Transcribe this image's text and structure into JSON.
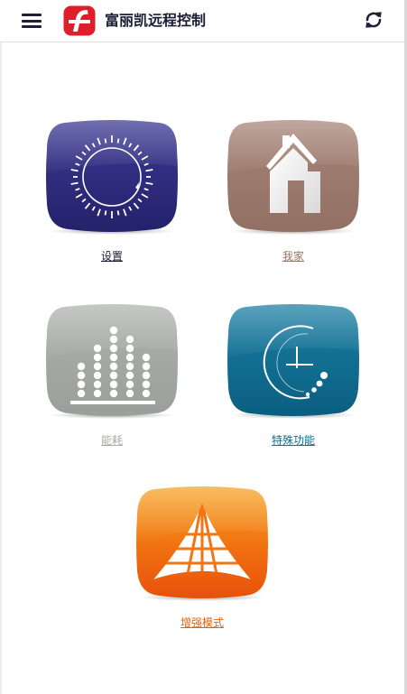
{
  "header": {
    "title": "富丽凯远程控制",
    "menu_icon": "hamburger-menu-icon",
    "logo_icon": "brand-logo-icon",
    "refresh_icon": "refresh-icon"
  },
  "tiles": [
    {
      "label": "设置",
      "icon": "dial-icon",
      "color": "#2c2b74"
    },
    {
      "label": "我家",
      "icon": "house-icon",
      "color": "#9e7a6d"
    },
    {
      "label": "能耗",
      "icon": "energy-bars-icon",
      "color": "#a5a9a5"
    },
    {
      "label": "特殊功能",
      "icon": "clock-function-icon",
      "color": "#0d6d91"
    },
    {
      "label": "增强模式",
      "icon": "perspective-grid-icon",
      "color": "#f07a0f"
    }
  ],
  "colors": {
    "brand_red": "#e01d2b",
    "header_text": "#1b1b35"
  }
}
